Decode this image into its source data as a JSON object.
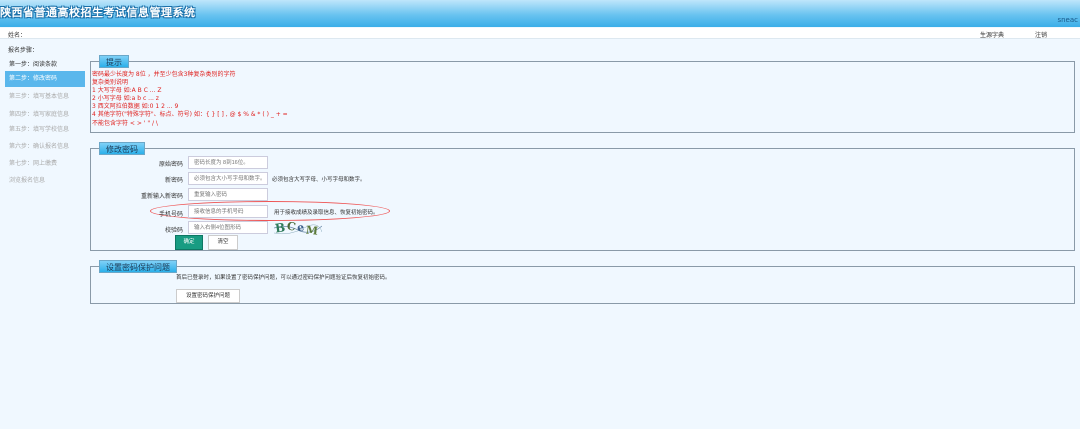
{
  "header": {
    "app_title": "陕西省普通高校招生考试信息管理系统",
    "right_label": "sneac"
  },
  "user_bar": {
    "name_label": "姓名：",
    "guide_link": "生源字典",
    "logout_link": "注销"
  },
  "sidebar": {
    "title": "报名步骤：",
    "steps": [
      {
        "label": "第一步：阅读条款",
        "state": "done"
      },
      {
        "label": "第二步：修改密码",
        "state": "active"
      },
      {
        "label": "第三步：填写基本信息",
        "state": "pending"
      },
      {
        "label": "第四步：填写家庭信息",
        "state": "pending"
      },
      {
        "label": "第五步：填写学校信息",
        "state": "pending"
      },
      {
        "label": "第六步：确认报名信息",
        "state": "pending"
      },
      {
        "label": "第七步：网上缴费",
        "state": "pending"
      },
      {
        "label": "浏览报名信息",
        "state": "pending"
      }
    ]
  },
  "tips": {
    "title": "提示",
    "lines": [
      "密码最少长度为 8位 ，并至少包含3种复杂类别的字符",
      "复杂类别说明",
      "1 大写字母 如:A B C ... Z",
      "2 小写字母 如:a b c ... z",
      "3 西文阿拉伯数据 如:0 1 2 ... 9",
      "4 其他字符(\"特殊字符\"、标点、符号) 如：{ } [ ] , @ $ % & * ( ) _ + =",
      "不能包含字符 < > ' \" / \\"
    ]
  },
  "change_password": {
    "title": "修改密码",
    "fields": [
      {
        "label": "原始密码",
        "placeholder": "密码长度为 8到16位。",
        "hint": ""
      },
      {
        "label": "新密码",
        "placeholder": "必须包含大小写字母和数字。",
        "hint": "必须包含大写字母、小写字母和数字。"
      },
      {
        "label": "重新输入新密码",
        "placeholder": "重复输入密码",
        "hint": ""
      },
      {
        "label": "手机号码",
        "placeholder": "接收信息的手机号码",
        "hint": "用于接收成绩及录取信息、恢复初始密码。"
      },
      {
        "label": "校验码",
        "placeholder": "输入右侧4位图形码",
        "hint": ""
      }
    ],
    "captcha_text": "BCeM",
    "confirm_label": "确定",
    "reset_label": "清空"
  },
  "security": {
    "title": "设置密码保护问题",
    "description": "首后已登录时，如果设置了密码保护问题，可以通过密码保护问题验证后恢复初始密码。",
    "button_label": "设置密码保护问题"
  },
  "colors": {
    "header_gradient_top": "#bfe6fb",
    "header_gradient_bottom": "#3aaee8",
    "active_step": "#5ab7ec",
    "tips_text": "#e0201e",
    "confirm_button": "#189c82",
    "panel_title": "#2bb0ea"
  }
}
